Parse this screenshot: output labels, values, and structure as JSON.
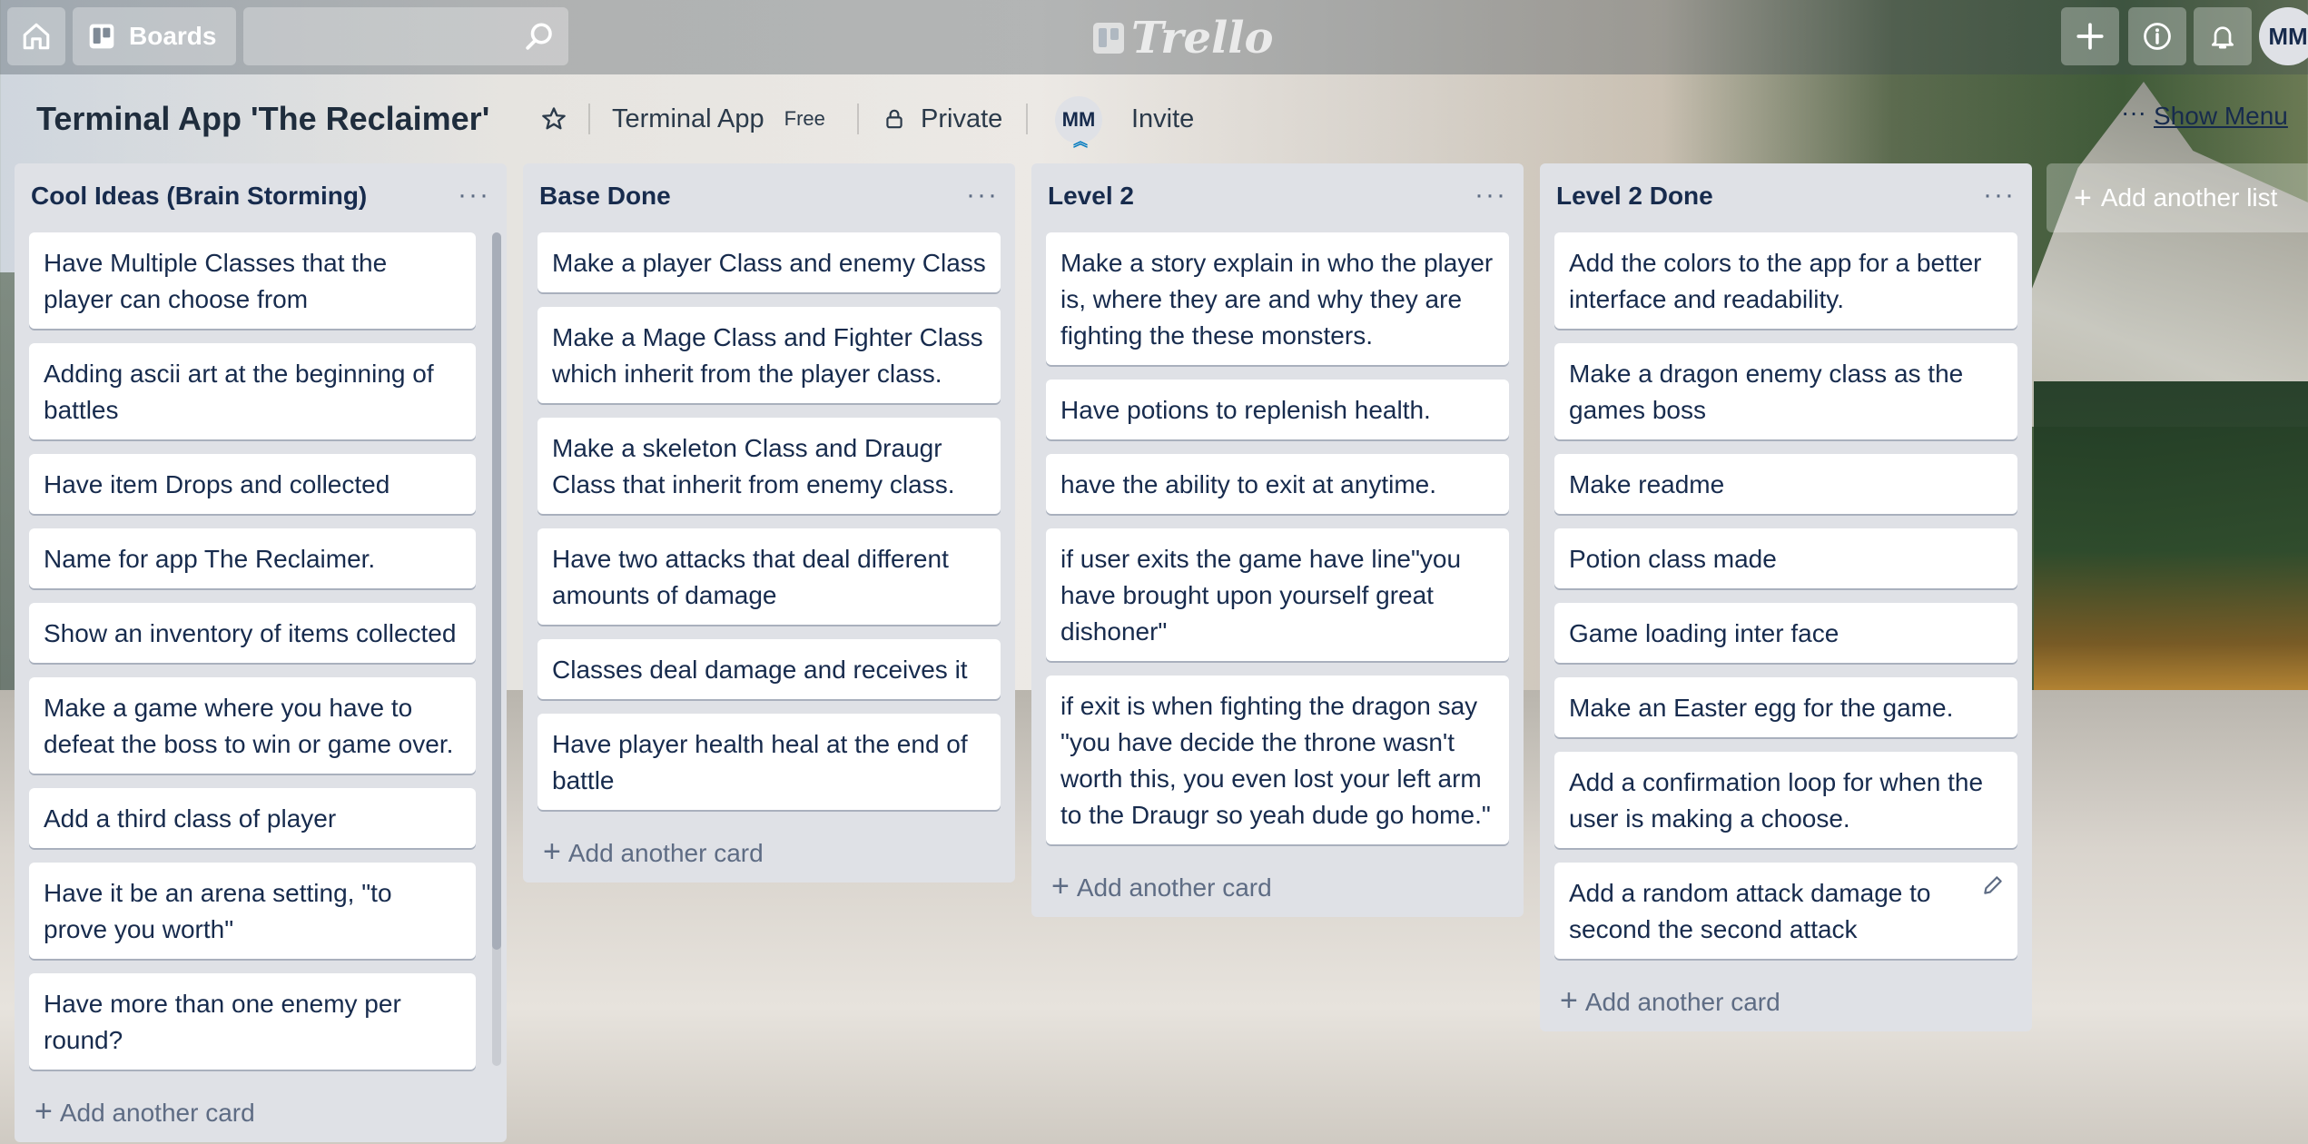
{
  "topbar": {
    "boards_label": "Boards",
    "search_placeholder": "",
    "logo_text": "Trello",
    "avatar_initials": "MM"
  },
  "board": {
    "title": "Terminal App 'The Reclaimer'",
    "team": "Terminal App",
    "team_badge": "Free",
    "visibility": "Private",
    "member_initials": "MM",
    "invite_label": "Invite",
    "show_menu_label": "Show Menu",
    "show_menu_dots": "···"
  },
  "lists": [
    {
      "title": "Cool Ideas (Brain Storming)",
      "menu": "···",
      "cards": [
        "Have Multiple Classes that the player can choose from",
        "Adding ascii art at the beginning of battles",
        "Have item Drops and collected",
        "Name for app The Reclaimer.",
        "Show an inventory of items collected",
        "Make a game where you have to defeat the boss to win or game over.",
        "Add a third class of player",
        "Have it be an arena setting, \"to prove you worth\"",
        "Have more than one enemy per round?"
      ],
      "add_card_label": "Add another card"
    },
    {
      "title": "Base Done",
      "menu": "···",
      "cards": [
        "Make a player Class and enemy Class",
        "Make a Mage Class and Fighter Class which inherit from the player class.",
        "Make a skeleton Class and Draugr Class that inherit from enemy class.",
        "Have two attacks that deal different amounts of damage",
        "Classes deal damage and receives it",
        "Have player health heal at the end of battle"
      ],
      "add_card_label": "Add another card"
    },
    {
      "title": "Level 2",
      "menu": "···",
      "cards": [
        "Make a story explain in who the player is, where they are and why they are fighting the these monsters.",
        "Have potions to replenish health.",
        "have the ability to exit at anytime.",
        "if user exits the game have line\"you have brought upon yourself great dishoner\"",
        "if exit is when fighting the dragon say \"you have decide the throne wasn't worth this, you even lost your left arm to the Draugr so yeah dude go home.\""
      ],
      "add_card_label": "Add another card"
    },
    {
      "title": "Level 2 Done",
      "menu": "···",
      "cards": [
        "Add the colors to the app for a better interface and readability.",
        "Make a dragon enemy class as the games boss",
        "Make readme",
        "Potion class made",
        "Game loading inter face",
        "Make an Easter egg for the game.",
        "Add a confirmation loop for when the user is making a choose.",
        "Add a random attack damage to second the second attack"
      ],
      "add_card_label": "Add another card"
    }
  ],
  "add_list_label": "Add another list"
}
